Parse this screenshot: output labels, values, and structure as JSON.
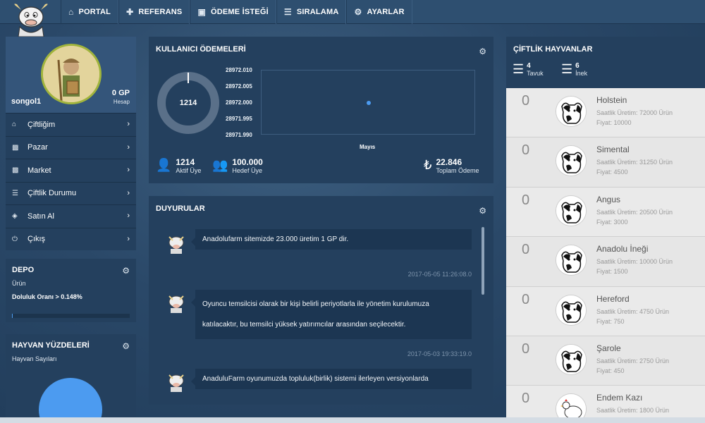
{
  "nav": {
    "items": [
      {
        "label": "PORTAL",
        "icon": "home-icon"
      },
      {
        "label": "REFERANS",
        "icon": "plus-icon"
      },
      {
        "label": "ÖDEME İSTEĞİ",
        "icon": "money-icon"
      },
      {
        "label": "SIRALAMA",
        "icon": "list-icon"
      },
      {
        "label": "AYARLAR",
        "icon": "gears-icon"
      }
    ]
  },
  "profile": {
    "username": "songol1",
    "gp": "0 GP",
    "gp_label": "Hesap"
  },
  "menu": {
    "items": [
      {
        "label": "Çiftliğim",
        "icon": "home-icon"
      },
      {
        "label": "Pazar",
        "icon": "image-icon"
      },
      {
        "label": "Market",
        "icon": "image-icon"
      },
      {
        "label": "Çiftlik Durumu",
        "icon": "list-icon"
      },
      {
        "label": "Satın Al",
        "icon": "gift-icon"
      },
      {
        "label": "Çıkış",
        "icon": "power-icon"
      }
    ]
  },
  "depo": {
    "title": "DEPO",
    "product_label": "Ürün",
    "fill_label": "Doluluk Oranı > 0.148%",
    "fill_fraction": 0.00148
  },
  "hayvan": {
    "title": "HAYVAN YÜZDELERİ",
    "subtitle": "Hayvan Sayıları"
  },
  "payments": {
    "title": "KULLANICI ÖDEMELERİ",
    "donut_value": "1214",
    "stats": [
      {
        "value": "1214",
        "label": "Aktif Üye",
        "icon": "user-icon"
      },
      {
        "value": "100.000",
        "label": "Hedef Üye",
        "icon": "users-icon"
      },
      {
        "value": "22.846",
        "label": "Toplam Ödeme",
        "icon": "lira-icon"
      }
    ]
  },
  "chart_data": {
    "type": "scatter",
    "title": "",
    "categories": [
      "Mayıs"
    ],
    "y_ticks": [
      "28972.010",
      "28972.005",
      "28972.000",
      "28971.995",
      "28971.990"
    ],
    "ylim": [
      28971.99,
      28972.01
    ],
    "series": [
      {
        "values": [
          28972.0
        ]
      }
    ],
    "grid": false
  },
  "duyurular": {
    "title": "DUYURULAR",
    "messages": [
      {
        "text": "Anadolufarm sitemizde 23.000 üretim 1 GP dir.",
        "time": "2017-05-05 11:26:08.0"
      },
      {
        "text_line1": "Oyuncu temsilcisi olarak bir kişi belirli periyotlarla ile yönetim kurulumuza",
        "text_line2": "katılacaktır, bu temsilci yüksek yatırımcılar arasından seçilecektir.",
        "time": "2017-05-03 19:33:19.0"
      },
      {
        "text": "AnaduluFarm oyunumuzda topluluk(birlik) sistemi ilerleyen versiyonlarda"
      }
    ]
  },
  "farm": {
    "title": "ÇİFTLİK HAYVANLAR",
    "counts": [
      {
        "value": "4",
        "label": "Tavuk",
        "icon": "list-icon"
      },
      {
        "value": "6",
        "label": "İnek",
        "icon": "list-icon"
      }
    ],
    "animals": [
      {
        "count": "0",
        "name": "Holstein",
        "production": "Saatlik Üretim: 72000 Ürün",
        "price": "Fiyat: 10000",
        "icon": "cow-icon"
      },
      {
        "count": "0",
        "name": "Simental",
        "production": "Saatlik Üretim: 31250 Ürün",
        "price": "Fiyat: 4500",
        "icon": "cow-icon"
      },
      {
        "count": "0",
        "name": "Angus",
        "production": "Saatlik Üretim: 20500 Ürün",
        "price": "Fiyat: 3000",
        "icon": "cow-icon"
      },
      {
        "count": "0",
        "name": "Anadolu İneği",
        "production": "Saatlik Üretim: 10000 Ürün",
        "price": "Fiyat: 1500",
        "icon": "cow-icon"
      },
      {
        "count": "0",
        "name": "Hereford",
        "production": "Saatlik Üretim: 4750 Ürün",
        "price": "Fiyat: 750",
        "icon": "cow-icon"
      },
      {
        "count": "0",
        "name": "Şarole",
        "production": "Saatlik Üretim: 2750 Ürün",
        "price": "Fiyat: 450",
        "icon": "cow-icon"
      },
      {
        "count": "0",
        "name": "Endem Kazı",
        "production": "Saatlik Üretim: 1800 Ürün",
        "price": "",
        "icon": "chicken-icon"
      }
    ]
  }
}
